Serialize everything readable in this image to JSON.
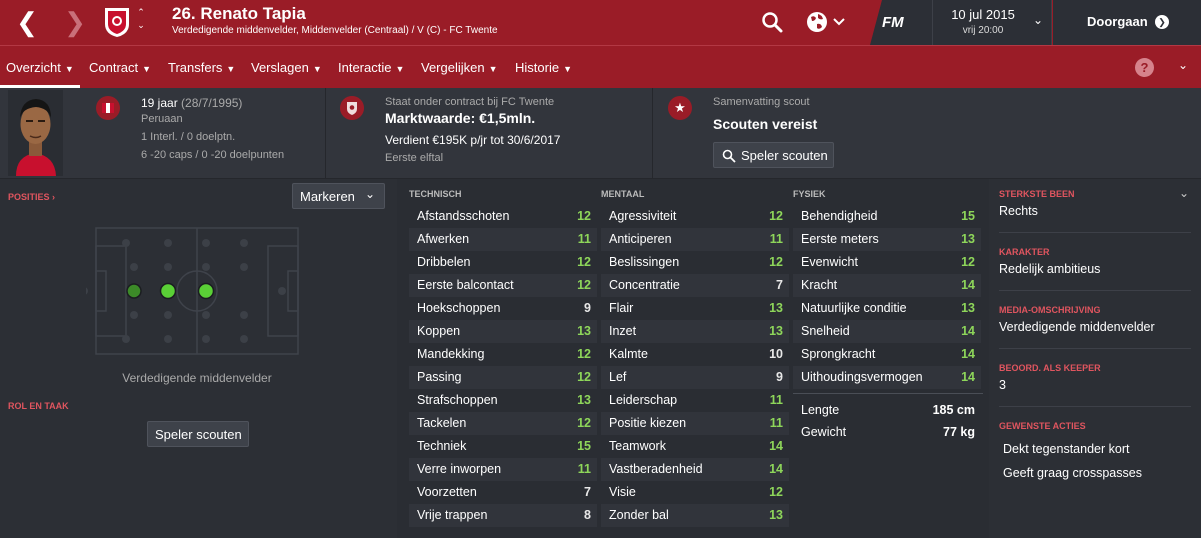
{
  "header": {
    "player_name": "26. Renato Tapia",
    "subtitle": "Verdedigende middenvelder, Middenvelder (Centraal) / V (C) - FC Twente",
    "fm_label": "FM",
    "date": "10 jul 2015",
    "time": "vrij 20:00",
    "continue_label": "Doorgaan"
  },
  "tabs": [
    {
      "label": "Overzicht"
    },
    {
      "label": "Contract"
    },
    {
      "label": "Transfers"
    },
    {
      "label": "Verslagen"
    },
    {
      "label": "Interactie"
    },
    {
      "label": "Vergelijken"
    },
    {
      "label": "Historie"
    }
  ],
  "help_label": "?",
  "info": {
    "age": "19 jaar",
    "dob": "(28/7/1995)",
    "nationality": "Peruaan",
    "intl": "1 Interl. / 0 doelptn.",
    "youth_caps": "6 -20 caps / 0 -20 doelpunten",
    "contract_status": "Staat onder contract bij FC Twente",
    "market_value": "Marktwaarde: €1,5mln.",
    "wage": "Verdient €195K p/jr tot 30/6/2017",
    "squad": "Eerste elftal",
    "scout_summary_label": "Samenvatting scout",
    "scout_required": "Scouten vereist",
    "scout_button": "Speler scouten"
  },
  "left": {
    "positions_label": "POSITIES",
    "highlight_label": "Markeren",
    "position_caption": "Verdedigende middenvelder",
    "role_label": "ROL EN TAAK",
    "scout_button": "Speler scouten"
  },
  "attributes": {
    "technical_header": "TECHNISCH",
    "mental_header": "MENTAAL",
    "physical_header": "FYSIEK",
    "technical": [
      {
        "name": "Afstandsschoten",
        "value": "12"
      },
      {
        "name": "Afwerken",
        "value": "11"
      },
      {
        "name": "Dribbelen",
        "value": "12"
      },
      {
        "name": "Eerste balcontact",
        "value": "12"
      },
      {
        "name": "Hoekschoppen",
        "value": "9"
      },
      {
        "name": "Koppen",
        "value": "13"
      },
      {
        "name": "Mandekking",
        "value": "12"
      },
      {
        "name": "Passing",
        "value": "12"
      },
      {
        "name": "Strafschoppen",
        "value": "13"
      },
      {
        "name": "Tackelen",
        "value": "12"
      },
      {
        "name": "Techniek",
        "value": "15"
      },
      {
        "name": "Verre inworpen",
        "value": "11"
      },
      {
        "name": "Voorzetten",
        "value": "7"
      },
      {
        "name": "Vrije trappen",
        "value": "8"
      }
    ],
    "mental": [
      {
        "name": "Agressiviteit",
        "value": "12"
      },
      {
        "name": "Anticiperen",
        "value": "11"
      },
      {
        "name": "Beslissingen",
        "value": "12"
      },
      {
        "name": "Concentratie",
        "value": "7"
      },
      {
        "name": "Flair",
        "value": "13"
      },
      {
        "name": "Inzet",
        "value": "13"
      },
      {
        "name": "Kalmte",
        "value": "10"
      },
      {
        "name": "Lef",
        "value": "9"
      },
      {
        "name": "Leiderschap",
        "value": "11"
      },
      {
        "name": "Positie kiezen",
        "value": "11"
      },
      {
        "name": "Teamwork",
        "value": "14"
      },
      {
        "name": "Vastberadenheid",
        "value": "14"
      },
      {
        "name": "Visie",
        "value": "12"
      },
      {
        "name": "Zonder bal",
        "value": "13"
      }
    ],
    "physical": [
      {
        "name": "Behendigheid",
        "value": "15"
      },
      {
        "name": "Eerste meters",
        "value": "13"
      },
      {
        "name": "Evenwicht",
        "value": "12"
      },
      {
        "name": "Kracht",
        "value": "14"
      },
      {
        "name": "Natuurlijke conditie",
        "value": "13"
      },
      {
        "name": "Snelheid",
        "value": "14"
      },
      {
        "name": "Sprongkracht",
        "value": "14"
      },
      {
        "name": "Uithoudingsvermogen",
        "value": "14"
      }
    ],
    "height_label": "Lengte",
    "height_value": "185 cm",
    "weight_label": "Gewicht",
    "weight_value": "77 kg"
  },
  "right": {
    "strongest_foot_label": "STERKSTE BEEN",
    "strongest_foot": "Rechts",
    "character_label": "KARAKTER",
    "character": "Redelijk ambitieus",
    "media_label": "MEDIA-OMSCHRIJVING",
    "media": "Verdedigende middenvelder",
    "keeper_label": "BEOORD. ALS KEEPER",
    "keeper": "3",
    "preferred_label": "GEWENSTE ACTIES",
    "preferred": [
      "Dekt tegenstander kort",
      "Geeft graag crosspasses"
    ]
  },
  "colors": {
    "brand": "#9a1c27",
    "good": "#8ed65a",
    "accent_label": "#e0555f"
  }
}
